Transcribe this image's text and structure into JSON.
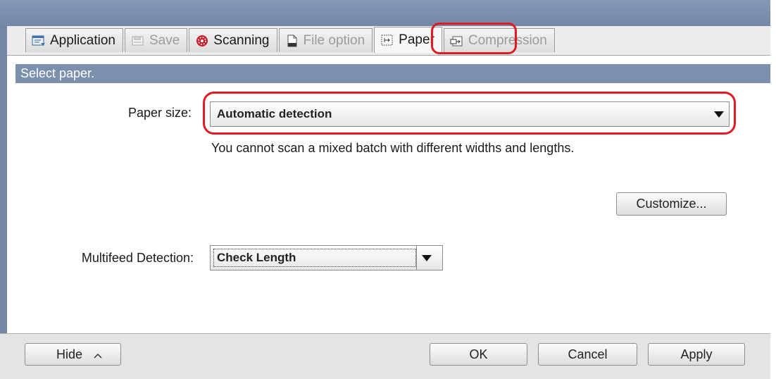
{
  "tabs": [
    {
      "label": "Application",
      "icon": "application-icon",
      "state": "normal"
    },
    {
      "label": "Save",
      "icon": "save-icon",
      "state": "disabled"
    },
    {
      "label": "Scanning",
      "icon": "scanning-icon",
      "state": "normal"
    },
    {
      "label": "File option",
      "icon": "file-option-icon",
      "state": "disabled"
    },
    {
      "label": "Paper",
      "icon": "paper-icon",
      "state": "active"
    },
    {
      "label": "Compression",
      "icon": "compression-icon",
      "state": "disabled"
    }
  ],
  "section": {
    "header": "Select paper."
  },
  "paper_size": {
    "label": "Paper size:",
    "value": "Automatic detection",
    "note": "You cannot scan a mixed batch with different widths and lengths."
  },
  "customize_button": "Customize...",
  "multifeed": {
    "label": "Multifeed Detection:",
    "value": "Check Length"
  },
  "footer": {
    "hide_label": "Hide",
    "ok_label": "OK",
    "cancel_label": "Cancel",
    "apply_label": "Apply"
  },
  "colors": {
    "highlight": "#e01b24",
    "section_header": "#7b90ad",
    "window_frame": "#7388a6"
  }
}
